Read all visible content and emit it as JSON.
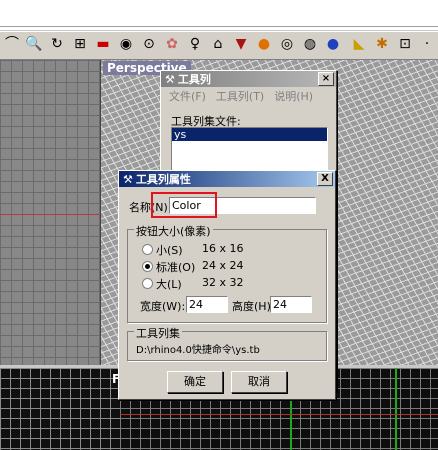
{
  "viewport": {
    "perspective_label": "Perspective",
    "bottom_left_letter": "F"
  },
  "toolbar": {
    "icons": [
      "lasso-icon",
      "zoom-icon",
      "rotate-view-icon",
      "grid-icon",
      "car-icon",
      "eye-icon",
      "target-icon",
      "color-icon",
      "light-icon",
      "lock-icon",
      "shield-icon",
      "sphere-icon",
      "ghost-sphere-icon",
      "render-sphere-icon",
      "blue-sphere-icon",
      "flag-icon",
      "gear-icon",
      "transform-icon"
    ]
  },
  "toolbar_collection_window": {
    "title": "工具列",
    "menu": [
      "文件(F)",
      "工具列(T)",
      "说明(H)"
    ],
    "files_label": "工具列集文件:",
    "files": [
      "ys"
    ]
  },
  "properties_dialog": {
    "title": "工具列属性",
    "name_label": "名称(N):",
    "name_value": "Color",
    "size_group_label": "按钮大小(像素)",
    "sizes": [
      {
        "label": "小(S)",
        "dims": "16 x 16",
        "selected": false
      },
      {
        "label": "标准(O)",
        "dims": "24 x 24",
        "selected": true
      },
      {
        "label": "大(L)",
        "dims": "32 x 32",
        "selected": false
      }
    ],
    "width_label": "宽度(W):",
    "width_value": "24",
    "height_label": "高度(H):",
    "height_value": "24",
    "collection_group_label": "工具列集",
    "collection_path": "D:\\rhino4.0快捷命令\\ys.tb",
    "ok_label": "确定",
    "cancel_label": "取消",
    "close_label": "X"
  },
  "colors": {
    "title_active": "#0a246a",
    "highlight_box": "#e0141e",
    "dialog_face": "#d4d0c8"
  }
}
